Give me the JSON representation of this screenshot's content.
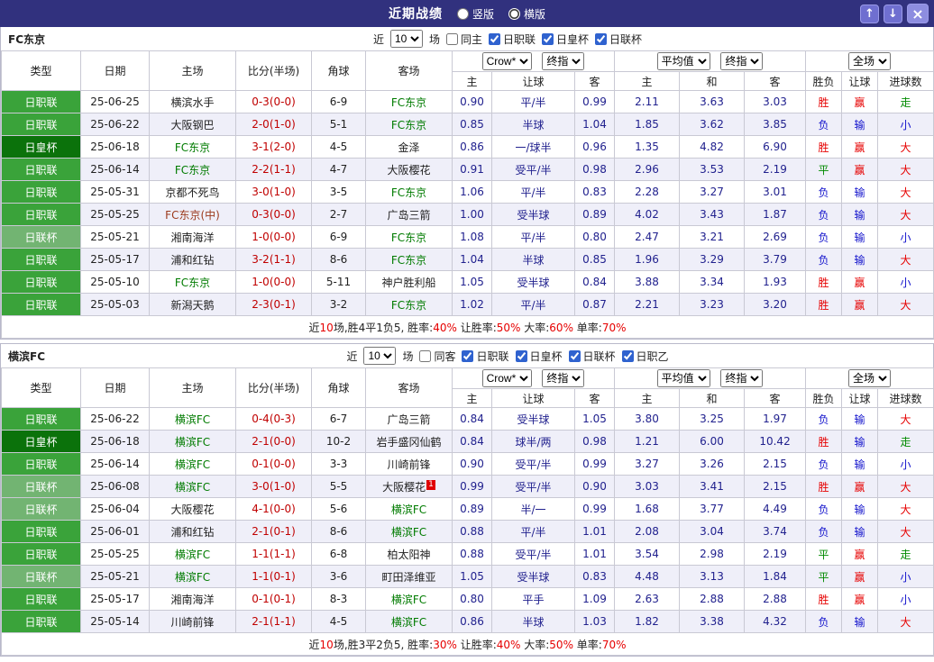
{
  "titlebar": {
    "title": "近期战绩",
    "radio_vertical": "竖版",
    "radio_horizontal": "横版",
    "selected": "横版",
    "icons": {
      "up": "↑",
      "down": "↓",
      "close": "×"
    },
    "colors": {
      "bar_bg": "#31317e",
      "league_green": "#3aa33a",
      "league_dark_green": "#0b720b",
      "league_light_green": "#72b472",
      "win_red": "#e60000",
      "lose_blue": "#1313cc",
      "draw_green": "#008a00"
    }
  },
  "table_labels": {
    "col_type": "类型",
    "col_date": "日期",
    "col_home": "主场",
    "col_score": "比分(半场)",
    "col_corner": "角球",
    "col_away": "客场",
    "dd_company": "Crow*",
    "dd_final": "终指",
    "dd_avg": "平均值",
    "dd_full": "全场",
    "sub_home": "主",
    "sub_handicap": "让球",
    "sub_away": "客",
    "sub_draw": "和",
    "sub_wl": "胜负",
    "sub_goals": "进球数"
  },
  "sections": [
    {
      "team": "FC东京",
      "filters": {
        "near_label": "近",
        "count": "10",
        "matches_label": "场",
        "same_label": "同主",
        "same_checked": false,
        "leagues": [
          {
            "label": "日职联",
            "checked": true
          },
          {
            "label": "日皇杯",
            "checked": true
          },
          {
            "label": "日联杯",
            "checked": true
          }
        ]
      },
      "rows": [
        {
          "league": "日职联",
          "date": "25-06-25",
          "home": "横滨水手",
          "home_c": "",
          "score": "0-3(0-0)",
          "corner": "6-9",
          "away": "FC东京",
          "away_c": "g",
          "odds": [
            "0.90",
            "平/半",
            "0.99"
          ],
          "avg": [
            "2.11",
            "3.63",
            "3.03"
          ],
          "res": [
            "胜",
            "赢",
            "走"
          ]
        },
        {
          "league": "日职联",
          "date": "25-06-22",
          "home": "大阪钢巴",
          "home_c": "",
          "score": "2-0(1-0)",
          "corner": "5-1",
          "away": "FC东京",
          "away_c": "g",
          "odds": [
            "0.85",
            "半球",
            "1.04"
          ],
          "avg": [
            "1.85",
            "3.62",
            "3.85"
          ],
          "res": [
            "负",
            "输",
            "小"
          ]
        },
        {
          "league": "日皇杯",
          "date": "25-06-18",
          "home": "FC东京",
          "home_c": "g",
          "score": "3-1(2-0)",
          "corner": "4-5",
          "away": "金泽",
          "away_c": "",
          "odds": [
            "0.86",
            "一/球半",
            "0.96"
          ],
          "avg": [
            "1.35",
            "4.82",
            "6.90"
          ],
          "res": [
            "胜",
            "赢",
            "大"
          ]
        },
        {
          "league": "日职联",
          "date": "25-06-14",
          "home": "FC东京",
          "home_c": "g",
          "score": "2-2(1-1)",
          "corner": "4-7",
          "away": "大阪樱花",
          "away_c": "",
          "odds": [
            "0.91",
            "受平/半",
            "0.98"
          ],
          "avg": [
            "2.96",
            "3.53",
            "2.19"
          ],
          "res": [
            "平",
            "赢",
            "大"
          ]
        },
        {
          "league": "日职联",
          "date": "25-05-31",
          "home": "京都不死鸟",
          "home_c": "",
          "score": "3-0(1-0)",
          "corner": "3-5",
          "away": "FC东京",
          "away_c": "g",
          "odds": [
            "1.06",
            "平/半",
            "0.83"
          ],
          "avg": [
            "2.28",
            "3.27",
            "3.01"
          ],
          "res": [
            "负",
            "输",
            "大"
          ]
        },
        {
          "league": "日职联",
          "date": "25-05-25",
          "home": "FC东京(中)",
          "home_c": "n",
          "score": "0-3(0-0)",
          "corner": "2-7",
          "away": "广岛三箭",
          "away_c": "",
          "odds": [
            "1.00",
            "受半球",
            "0.89"
          ],
          "avg": [
            "4.02",
            "3.43",
            "1.87"
          ],
          "res": [
            "负",
            "输",
            "大"
          ]
        },
        {
          "league": "日联杯",
          "date": "25-05-21",
          "home": "湘南海洋",
          "home_c": "",
          "score": "1-0(0-0)",
          "corner": "6-9",
          "away": "FC东京",
          "away_c": "g",
          "odds": [
            "1.08",
            "平/半",
            "0.80"
          ],
          "avg": [
            "2.47",
            "3.21",
            "2.69"
          ],
          "res": [
            "负",
            "输",
            "小"
          ]
        },
        {
          "league": "日职联",
          "date": "25-05-17",
          "home": "浦和红钻",
          "home_c": "",
          "score": "3-2(1-1)",
          "corner": "8-6",
          "away": "FC东京",
          "away_c": "g",
          "odds": [
            "1.04",
            "半球",
            "0.85"
          ],
          "avg": [
            "1.96",
            "3.29",
            "3.79"
          ],
          "res": [
            "负",
            "输",
            "大"
          ]
        },
        {
          "league": "日职联",
          "date": "25-05-10",
          "home": "FC东京",
          "home_c": "g",
          "score": "1-0(0-0)",
          "corner": "5-11",
          "away": "神户胜利船",
          "away_c": "",
          "odds": [
            "1.05",
            "受半球",
            "0.84"
          ],
          "avg": [
            "3.88",
            "3.34",
            "1.93"
          ],
          "res": [
            "胜",
            "赢",
            "小"
          ]
        },
        {
          "league": "日职联",
          "date": "25-05-03",
          "home": "新潟天鹅",
          "home_c": "",
          "score": "2-3(0-1)",
          "corner": "3-2",
          "away": "FC东京",
          "away_c": "g",
          "odds": [
            "1.02",
            "平/半",
            "0.87"
          ],
          "avg": [
            "2.21",
            "3.23",
            "3.20"
          ],
          "res": [
            "胜",
            "赢",
            "大"
          ]
        }
      ],
      "summary": [
        {
          "t": "近"
        },
        {
          "t": "10",
          "c": "r"
        },
        {
          "t": "场,胜4平1负5, 胜率:"
        },
        {
          "t": "40%",
          "c": "r"
        },
        {
          "t": " 让胜率:"
        },
        {
          "t": "50%",
          "c": "r"
        },
        {
          "t": " 大率:"
        },
        {
          "t": "60%",
          "c": "r"
        },
        {
          "t": " 单率:"
        },
        {
          "t": "70%",
          "c": "r"
        }
      ]
    },
    {
      "team": "横滨FC",
      "filters": {
        "near_label": "近",
        "count": "10",
        "matches_label": "场",
        "same_label": "同客",
        "same_checked": false,
        "leagues": [
          {
            "label": "日职联",
            "checked": true
          },
          {
            "label": "日皇杯",
            "checked": true
          },
          {
            "label": "日联杯",
            "checked": true
          },
          {
            "label": "日职乙",
            "checked": true
          }
        ]
      },
      "rows": [
        {
          "league": "日职联",
          "date": "25-06-22",
          "home": "横滨FC",
          "home_c": "g",
          "score": "0-4(0-3)",
          "corner": "6-7",
          "away": "广岛三箭",
          "away_c": "",
          "odds": [
            "0.84",
            "受半球",
            "1.05"
          ],
          "avg": [
            "3.80",
            "3.25",
            "1.97"
          ],
          "res": [
            "负",
            "输",
            "大"
          ]
        },
        {
          "league": "日皇杯",
          "date": "25-06-18",
          "home": "横滨FC",
          "home_c": "g",
          "score": "2-1(0-0)",
          "corner": "10-2",
          "away": "岩手盛冈仙鹤",
          "away_c": "",
          "odds": [
            "0.84",
            "球半/两",
            "0.98"
          ],
          "avg": [
            "1.21",
            "6.00",
            "10.42"
          ],
          "res": [
            "胜",
            "输",
            "走"
          ]
        },
        {
          "league": "日职联",
          "date": "25-06-14",
          "home": "横滨FC",
          "home_c": "g",
          "score": "0-1(0-0)",
          "corner": "3-3",
          "away": "川崎前锋",
          "away_c": "",
          "odds": [
            "0.90",
            "受平/半",
            "0.99"
          ],
          "avg": [
            "3.27",
            "3.26",
            "2.15"
          ],
          "res": [
            "负",
            "输",
            "小"
          ]
        },
        {
          "league": "日联杯",
          "date": "25-06-08",
          "home": "横滨FC",
          "home_c": "g",
          "score": "3-0(1-0)",
          "corner": "5-5",
          "away": "大阪樱花",
          "away_c": "",
          "away_sup": "1",
          "odds": [
            "0.99",
            "受平/半",
            "0.90"
          ],
          "avg": [
            "3.03",
            "3.41",
            "2.15"
          ],
          "res": [
            "胜",
            "赢",
            "大"
          ]
        },
        {
          "league": "日联杯",
          "date": "25-06-04",
          "home": "大阪樱花",
          "home_c": "",
          "score": "4-1(0-0)",
          "corner": "5-6",
          "away": "横滨FC",
          "away_c": "g",
          "odds": [
            "0.89",
            "半/一",
            "0.99"
          ],
          "avg": [
            "1.68",
            "3.77",
            "4.49"
          ],
          "res": [
            "负",
            "输",
            "大"
          ]
        },
        {
          "league": "日职联",
          "date": "25-06-01",
          "home": "浦和红钻",
          "home_c": "",
          "score": "2-1(0-1)",
          "corner": "8-6",
          "away": "横滨FC",
          "away_c": "g",
          "odds": [
            "0.88",
            "平/半",
            "1.01"
          ],
          "avg": [
            "2.08",
            "3.04",
            "3.74"
          ],
          "res": [
            "负",
            "输",
            "大"
          ]
        },
        {
          "league": "日职联",
          "date": "25-05-25",
          "home": "横滨FC",
          "home_c": "g",
          "score": "1-1(1-1)",
          "corner": "6-8",
          "away": "柏太阳神",
          "away_c": "",
          "odds": [
            "0.88",
            "受平/半",
            "1.01"
          ],
          "avg": [
            "3.54",
            "2.98",
            "2.19"
          ],
          "res": [
            "平",
            "赢",
            "走"
          ]
        },
        {
          "league": "日联杯",
          "date": "25-05-21",
          "home": "横滨FC",
          "home_c": "g",
          "score": "1-1(0-1)",
          "corner": "3-6",
          "away": "町田泽维亚",
          "away_c": "",
          "odds": [
            "1.05",
            "受半球",
            "0.83"
          ],
          "avg": [
            "4.48",
            "3.13",
            "1.84"
          ],
          "res": [
            "平",
            "赢",
            "小"
          ]
        },
        {
          "league": "日职联",
          "date": "25-05-17",
          "home": "湘南海洋",
          "home_c": "",
          "score": "0-1(0-1)",
          "corner": "8-3",
          "away": "横滨FC",
          "away_c": "g",
          "odds": [
            "0.80",
            "平手",
            "1.09"
          ],
          "avg": [
            "2.63",
            "2.88",
            "2.88"
          ],
          "res": [
            "胜",
            "赢",
            "小"
          ]
        },
        {
          "league": "日职联",
          "date": "25-05-14",
          "home": "川崎前锋",
          "home_c": "",
          "score": "2-1(1-1)",
          "corner": "4-5",
          "away": "横滨FC",
          "away_c": "g",
          "odds": [
            "0.86",
            "半球",
            "1.03"
          ],
          "avg": [
            "1.82",
            "3.38",
            "4.32"
          ],
          "res": [
            "负",
            "输",
            "大"
          ]
        }
      ],
      "summary": [
        {
          "t": "近"
        },
        {
          "t": "10",
          "c": "r"
        },
        {
          "t": "场,胜3平2负5, 胜率:"
        },
        {
          "t": "30%",
          "c": "r"
        },
        {
          "t": " 让胜率:"
        },
        {
          "t": "40%",
          "c": "r"
        },
        {
          "t": " 大率:"
        },
        {
          "t": "50%",
          "c": "r"
        },
        {
          "t": " 单率:"
        },
        {
          "t": "70%",
          "c": "r"
        }
      ]
    }
  ]
}
